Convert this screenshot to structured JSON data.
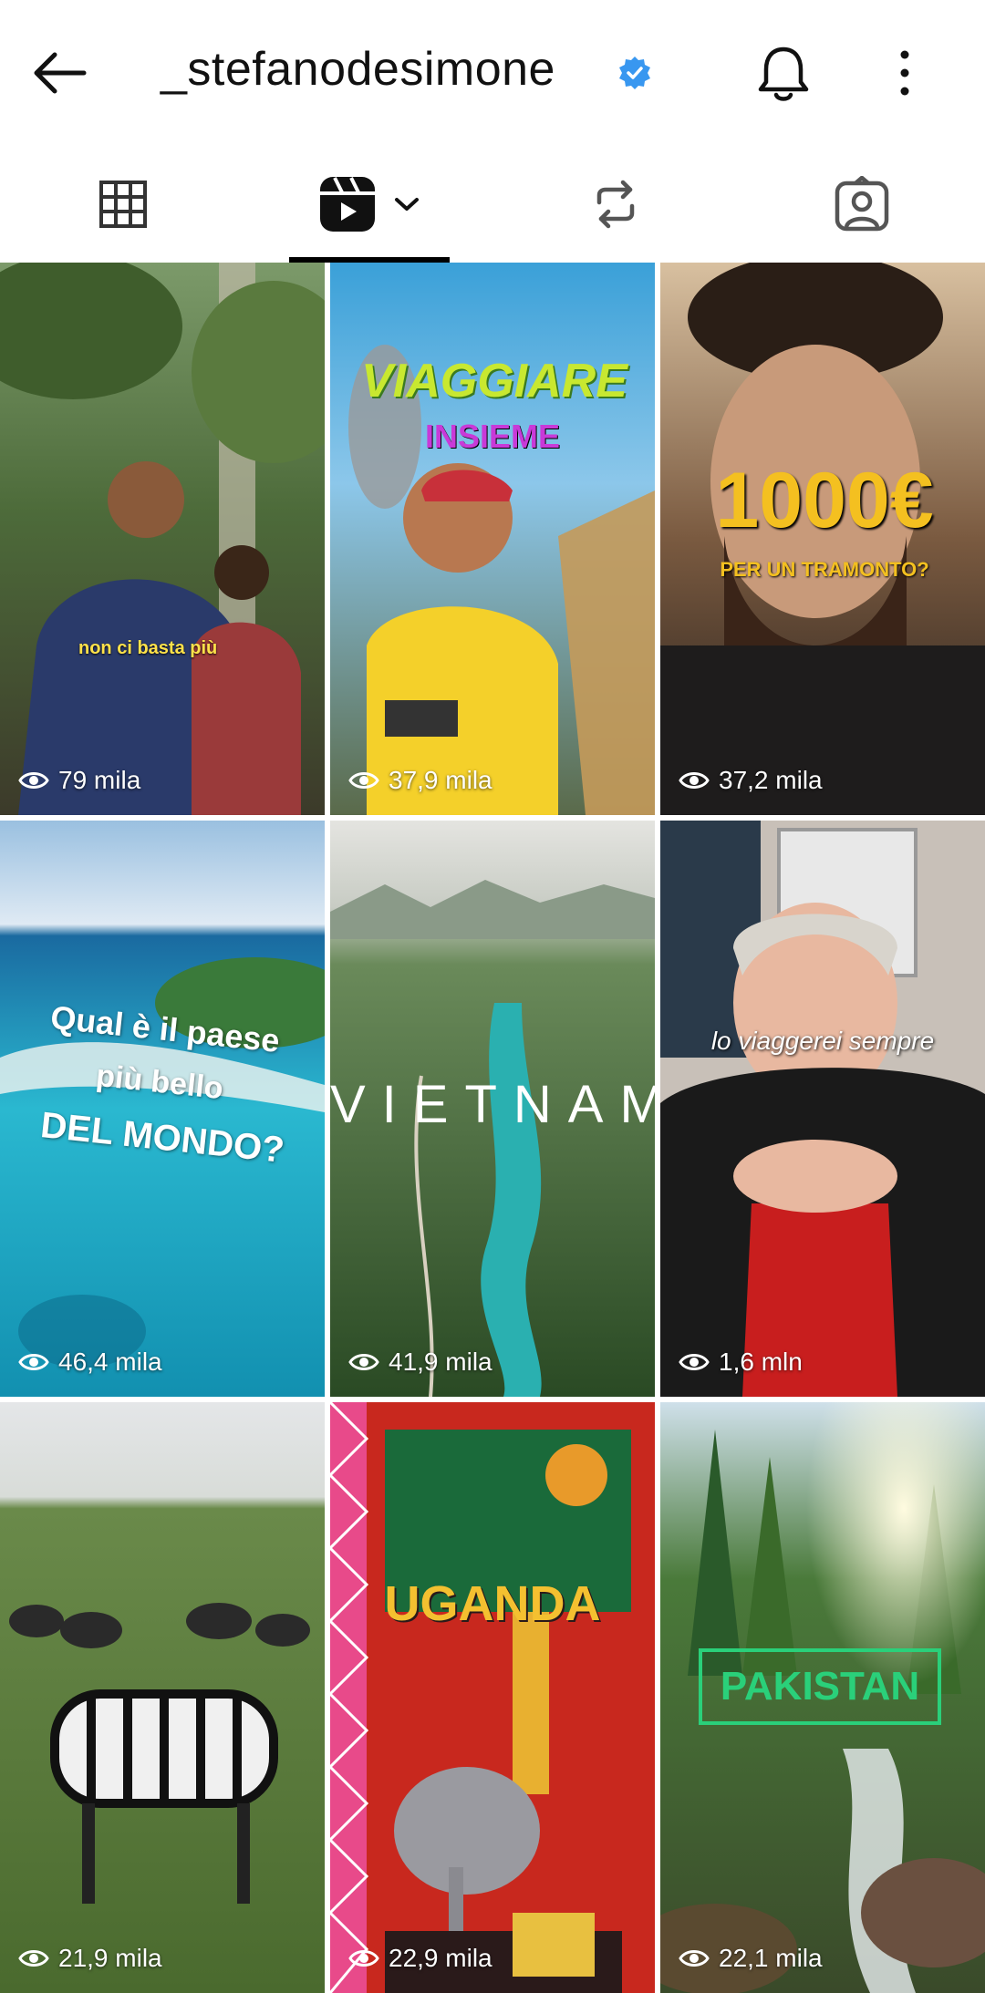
{
  "header": {
    "username": "_stefanodesimone",
    "verified_color": "#3897f0"
  },
  "tabs": [
    {
      "icon": "grid-icon"
    },
    {
      "icon": "reels-icon",
      "active": true
    },
    {
      "icon": "reposts-icon"
    },
    {
      "icon": "tagged-icon"
    }
  ],
  "reels": [
    {
      "overlay": "non ci basta più",
      "views": "79 mila"
    },
    {
      "overlay_line1": "VIAGGIARE",
      "overlay_line2": "INSIEME",
      "views": "37,9 mila"
    },
    {
      "overlay_line1": "1000€",
      "overlay_line2": "PER UN TRAMONTO?",
      "views": "37,2 mila"
    },
    {
      "overlay_line1": "Qual è il paese",
      "overlay_line2": "più bello",
      "overlay_line3": "DEL MONDO?",
      "views": "46,4 mila"
    },
    {
      "overlay": "VIETNAM",
      "views": "41,9 mila"
    },
    {
      "overlay": "lo viaggerei sempre",
      "views": "1,6 mln"
    },
    {
      "views": "21,9 mila"
    },
    {
      "overlay": "UGANDA",
      "views": "22,9 mila"
    },
    {
      "overlay": "PAKISTAN",
      "views": "22,1 mila"
    }
  ]
}
